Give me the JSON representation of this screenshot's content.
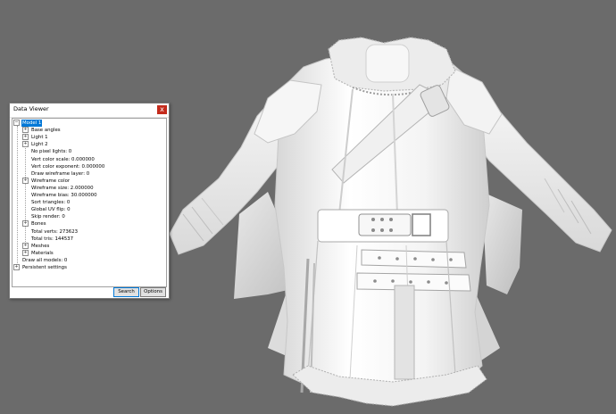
{
  "window": {
    "title": "Data Viewer",
    "close_glyph": "x"
  },
  "tree": [
    {
      "label": "Model 1",
      "level": 0,
      "expander": "−",
      "selected": true
    },
    {
      "label": "Base angles",
      "level": 1,
      "expander": "+"
    },
    {
      "label": "Light 1",
      "level": 1,
      "expander": "+"
    },
    {
      "label": "Light 2",
      "level": 1,
      "expander": "+"
    },
    {
      "label": "No pixel lights: 0",
      "level": 1,
      "expander": ""
    },
    {
      "label": "Vert color scale: 0.000000",
      "level": 1,
      "expander": ""
    },
    {
      "label": "Vert color exponent: 0.000000",
      "level": 1,
      "expander": ""
    },
    {
      "label": "Draw wireframe layer: 0",
      "level": 1,
      "expander": ""
    },
    {
      "label": "Wireframe color",
      "level": 1,
      "expander": "+"
    },
    {
      "label": "Wireframe size: 2.000000",
      "level": 1,
      "expander": ""
    },
    {
      "label": "Wireframe bias: 30.000000",
      "level": 1,
      "expander": ""
    },
    {
      "label": "Sort triangles: 0",
      "level": 1,
      "expander": ""
    },
    {
      "label": "Global UV flip: 0",
      "level": 1,
      "expander": ""
    },
    {
      "label": "Skip render: 0",
      "level": 1,
      "expander": ""
    },
    {
      "label": "Bones",
      "level": 1,
      "expander": "+"
    },
    {
      "label": "Total verts: 273623",
      "level": 1,
      "expander": ""
    },
    {
      "label": "Total tris: 144537",
      "level": 1,
      "expander": ""
    },
    {
      "label": "Meshes",
      "level": 1,
      "expander": "+"
    },
    {
      "label": "Materials",
      "level": 1,
      "expander": "+"
    },
    {
      "label": "Draw all models: 0",
      "level": 0,
      "expander": ""
    },
    {
      "label": "Persistent settings",
      "level": 0,
      "expander": "+"
    }
  ],
  "buttons": {
    "search": "Search",
    "options": "Options"
  },
  "colors": {
    "background": "#6b6b6b",
    "model": "#f2f2f2",
    "selection": "#0078d7"
  }
}
